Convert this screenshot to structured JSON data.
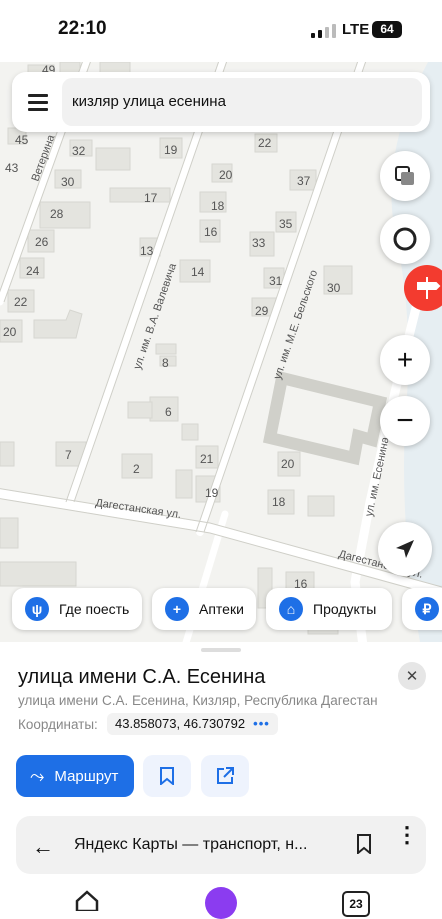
{
  "status_bar": {
    "time": "22:10",
    "network": "LTE",
    "battery": "64"
  },
  "search": {
    "query": "кизляр улица есенина"
  },
  "map": {
    "streets": [
      "ул. им. В.А. Валевича",
      "ул. им. М.Е. Бельского",
      "Дагестанская ул.",
      "Дагестанская ул.",
      "Ветерина",
      "ул. им. Есенина"
    ],
    "house_numbers": [
      "49",
      "45",
      "43",
      "32",
      "30",
      "28",
      "26",
      "24",
      "22",
      "20",
      "19",
      "17",
      "13",
      "14",
      "16",
      "18",
      "20",
      "22",
      "37",
      "35",
      "33",
      "31",
      "30",
      "29",
      "8",
      "6",
      "7",
      "2",
      "21",
      "19",
      "20",
      "18",
      "16",
      "13"
    ]
  },
  "categories": [
    {
      "label": "Где поесть",
      "icon": "fork-knife-icon"
    },
    {
      "label": "Аптеки",
      "icon": "plus-icon"
    },
    {
      "label": "Продукты",
      "icon": "basket-icon"
    }
  ],
  "place": {
    "title": "улица имени С.А. Есенина",
    "subtitle": "улица имени С.А. Есенина, Кизляр, Республика Дагестан",
    "coords_label": "Координаты:",
    "coords_value": "43.858073, 46.730792"
  },
  "actions": {
    "route_label": "Маршрут"
  },
  "tab": {
    "title": "Яндекс Карты — транспорт, н..."
  },
  "bottom_nav": {
    "tabs_count": "23"
  },
  "colors": {
    "accent": "#1e6fe6",
    "pin": "#f33b2f",
    "map_bg": "#f3f3f0",
    "building": "#e4e4df"
  }
}
